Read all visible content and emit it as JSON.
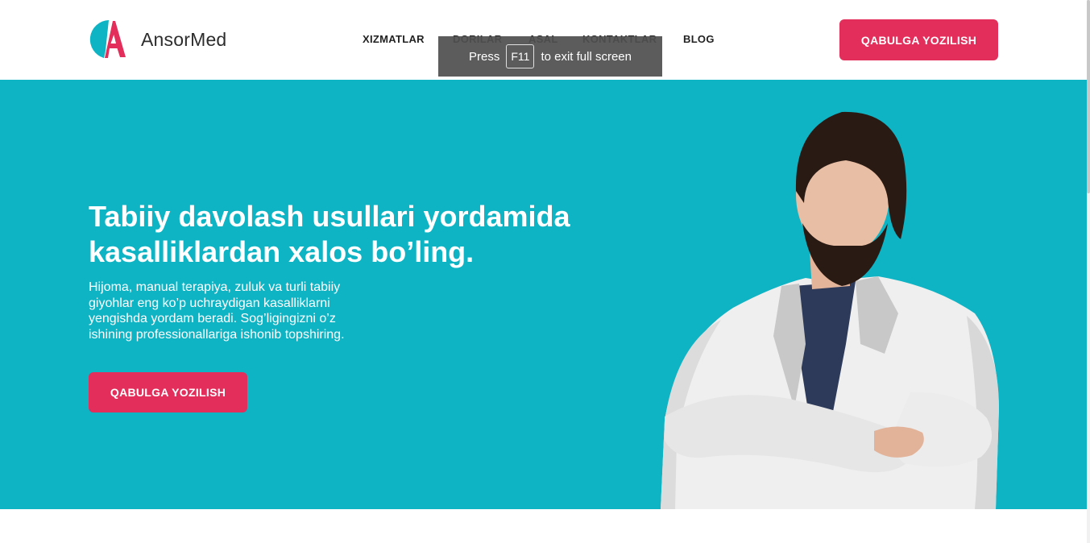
{
  "brand": {
    "name": "AnsorMed",
    "logo_letter": "A",
    "colors": {
      "teal": "#0eb3c4",
      "accent": "#e32d5a"
    }
  },
  "nav": {
    "items": [
      {
        "label": "XIZMATLAR"
      },
      {
        "label": "DORILAR"
      },
      {
        "label": "ASAL"
      },
      {
        "label": "KONTAKTLAR"
      },
      {
        "label": "BLOG"
      }
    ]
  },
  "header": {
    "cta_label": "QABULGA YOZILISH"
  },
  "fullscreen_toast": {
    "prefix": "Press",
    "key": "F11",
    "suffix": "to exit full screen"
  },
  "hero": {
    "title_line1": "Tabiiy davolash usullari yordamida",
    "title_line2": "kasalliklardan xalos bo’ling.",
    "description": "Hijoma, manual terapiya, zuluk va turli tabiiy giyohlar eng ko’p uchraydigan kasalliklarni yengishda yordam beradi. Sog’ligingizni o’z ishining professionallariga ishonib topshiring.",
    "cta_label": "QABULGA YOZILISH",
    "image": "doctor-photo"
  }
}
